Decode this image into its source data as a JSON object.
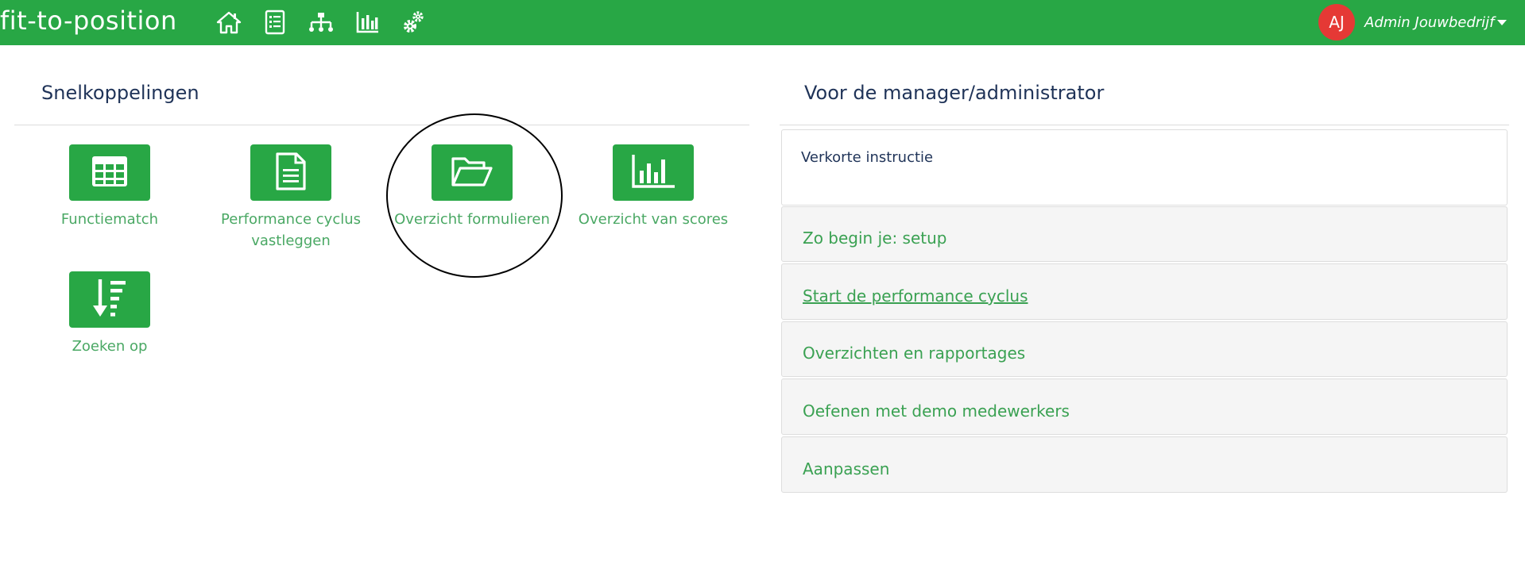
{
  "topbar": {
    "logo": "fit-to-position",
    "nav_icons": [
      "home-icon",
      "checklist-icon",
      "org-chart-icon",
      "bar-chart-icon",
      "gears-icon"
    ],
    "user": {
      "initials": "AJ",
      "name": "Admin Jouwbedrijf"
    }
  },
  "shortcuts": {
    "title": "Snelkoppelingen",
    "items": [
      {
        "label": "Functiematch",
        "icon": "table-icon"
      },
      {
        "label": "Performance cyclus vastleggen",
        "icon": "document-icon"
      },
      {
        "label": "Overzicht formulieren",
        "icon": "folder-open-icon"
      },
      {
        "label": "Overzicht van scores",
        "icon": "bar-chart-icon"
      },
      {
        "label": "Zoeken op",
        "icon": "sort-down-icon"
      }
    ]
  },
  "manager": {
    "title": "Voor de manager/administrator",
    "intro": "Verkorte instructie",
    "items": [
      {
        "label": "Zo begin je: setup"
      },
      {
        "label": "Start de performance cyclus"
      },
      {
        "label": "Overzichten en rapportages"
      },
      {
        "label": "Oefenen met demo medewerkers"
      },
      {
        "label": "Aanpassen"
      }
    ]
  },
  "colors": {
    "brand": "#28a745",
    "heading": "#1f3358",
    "avatar": "#e53935",
    "link": "#3aa152"
  }
}
